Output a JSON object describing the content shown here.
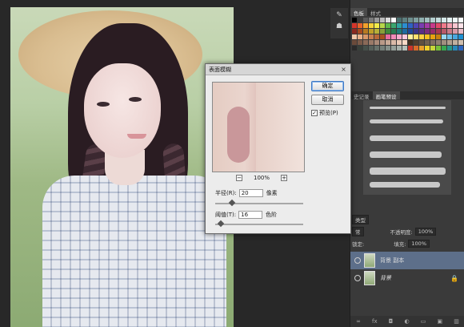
{
  "dialog": {
    "title": "表面模糊",
    "close": "×",
    "ok": "确定",
    "cancel": "取消",
    "preview_label": "预览(P)",
    "preview_checked": "✓",
    "zoom": "100%",
    "zoom_out": "−",
    "zoom_in": "+",
    "radius_label": "半径(R):",
    "radius_value": "20",
    "radius_unit": "像素",
    "threshold_label": "阈值(T):",
    "threshold_value": "16",
    "threshold_unit": "色阶"
  },
  "panels": {
    "swatches_tab": "色板",
    "styles_tab": "样式",
    "history_tab": "史记录",
    "brush_preset_tab": "画笔预设",
    "layers": {
      "kind_label": "类型",
      "blend_mode": "常",
      "opacity_label": "不透明度:",
      "opacity_value": "100%",
      "lock_label": "锁定:",
      "fill_label": "填充:",
      "fill_value": "100%",
      "items": [
        {
          "name": "背景 副本",
          "selected": true
        },
        {
          "name": "背景",
          "selected": false
        }
      ]
    },
    "bottom_icons": [
      "link-icon",
      "fx-icon",
      "mask-icon",
      "adjustment-icon",
      "folder-icon",
      "new-layer-icon",
      "trash-icon"
    ],
    "bottom_glyphs": [
      "∞",
      "fx",
      "◘",
      "◐",
      "▭",
      "▣",
      "▥"
    ]
  },
  "toolstrip": {
    "icons": [
      "eyedropper-icon",
      "palette-icon"
    ],
    "glyphs": [
      "✎",
      "☗"
    ]
  },
  "swatch_colors": [
    "#000000",
    "#3c3c3c",
    "#5a5a5a",
    "#7a7a7a",
    "#9a9a9a",
    "#bcbcbc",
    "#dcdcdc",
    "#ffffff",
    "#4a6f6f",
    "#5e8080",
    "#6d8f8f",
    "#7f9f9f",
    "#8fb0b0",
    "#a2c0c0",
    "#b4cfcf",
    "#c4dcdc",
    "#d5e8e8",
    "#e4f2f2",
    "#eef8f8",
    "#f6fbfb",
    "#d4342a",
    "#e8632a",
    "#f2a12c",
    "#f6d23a",
    "#f3ec4a",
    "#b7d64a",
    "#5fb84a",
    "#3aa66e",
    "#2fa3a0",
    "#2b8ed0",
    "#2e61c4",
    "#4f45b3",
    "#7a3db0",
    "#a23aa5",
    "#c73a8a",
    "#e04a6a",
    "#f07a8a",
    "#f4a0b0",
    "#f8c6d0",
    "#fde4ea",
    "#8a2a20",
    "#a84a20",
    "#b87a22",
    "#c0a028",
    "#b8b038",
    "#88a038",
    "#40883a",
    "#287a50",
    "#207a78",
    "#1e6aa0",
    "#214898",
    "#3a3488",
    "#5a2e86",
    "#7a2c7e",
    "#962c68",
    "#a83850",
    "#b85a68",
    "#c87a88",
    "#d89aa8",
    "#e8bac6",
    "#f0c8a8",
    "#e8b088",
    "#d89868",
    "#c88050",
    "#b86838",
    "#a85020",
    "#e86aa0",
    "#f28ab8",
    "#f6aacc",
    "#fbcae0",
    "#fff0a0",
    "#ffe070",
    "#ffd040",
    "#f8c020",
    "#e8a010",
    "#c88010",
    "#9ad8f0",
    "#70c0e8",
    "#48a8e0",
    "#2090d0",
    "#6a4a3a",
    "#7a5a48",
    "#8a6a58",
    "#9a7a68",
    "#aa8a78",
    "#ba9a88",
    "#caaa98",
    "#dabaa8",
    "#eacab8",
    "#f8dac8",
    "#403020",
    "#504030",
    "#605040",
    "#706050",
    "#807060",
    "#908070",
    "#a09080",
    "#b0a090",
    "#c0b0a0",
    "#d0c0b0",
    "#2a2a2a",
    "#38403a",
    "#46504a",
    "#56605a",
    "#66706a",
    "#76807a",
    "#86908a",
    "#96a09a",
    "#a6b0aa",
    "#b6c0ba",
    "#c8342a",
    "#d86a2a",
    "#e8a02a",
    "#f0d02a",
    "#c8d83a",
    "#78c03a",
    "#38a850",
    "#289888",
    "#2888b8",
    "#3068c0"
  ]
}
